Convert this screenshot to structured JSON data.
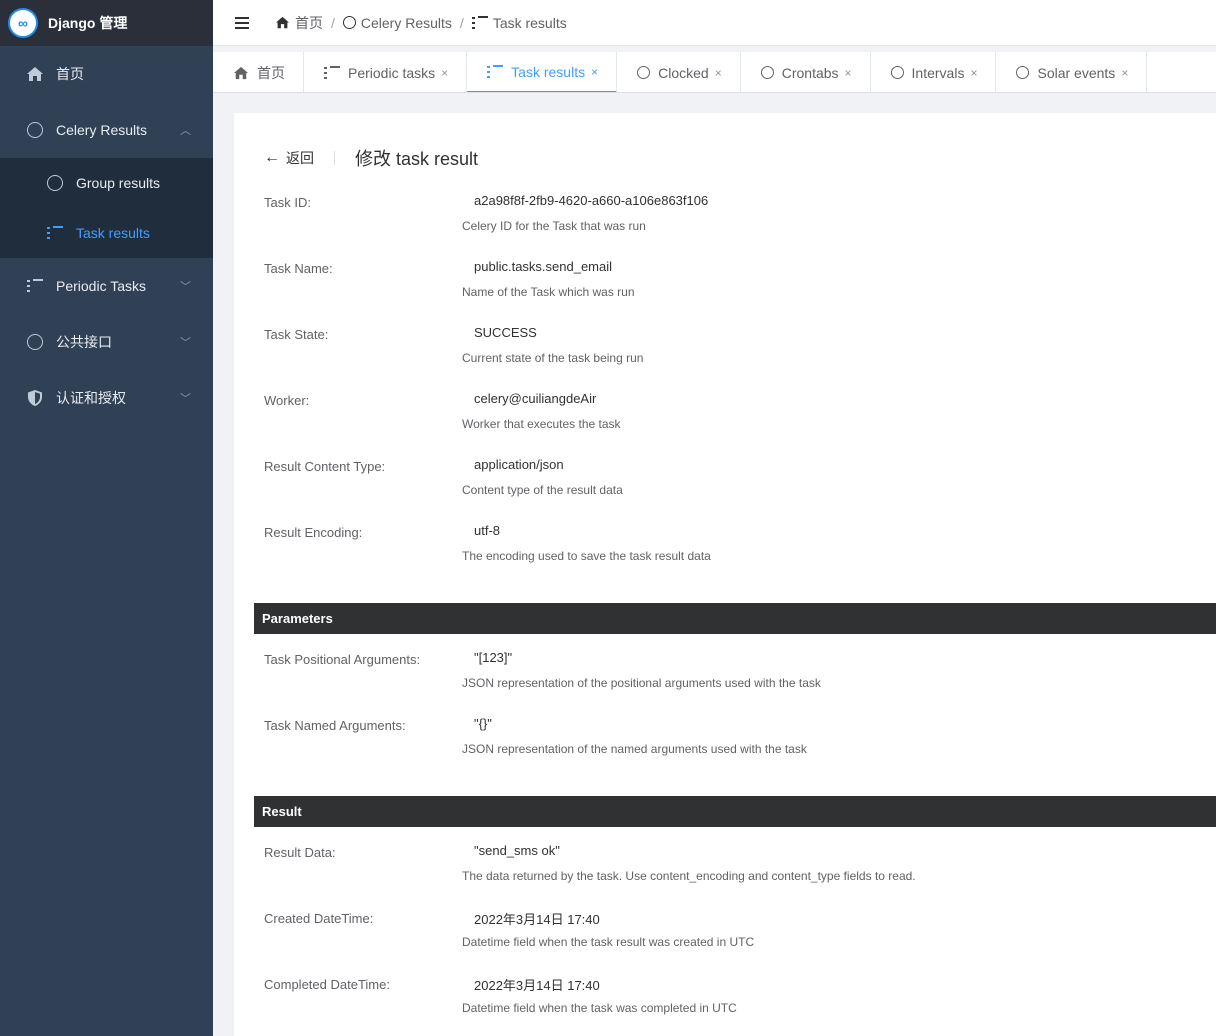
{
  "app": {
    "logo_text": "∞",
    "title": "Django 管理"
  },
  "sidebar": {
    "items": [
      {
        "label": "首页",
        "icon": "home-icon"
      },
      {
        "label": "Celery Results",
        "icon": "circle-icon",
        "chevron": "︿",
        "children": [
          {
            "label": "Group results",
            "icon": "circle-icon"
          },
          {
            "label": "Task results",
            "icon": "list-icon",
            "active": true
          }
        ]
      },
      {
        "label": "Periodic Tasks",
        "icon": "list-icon",
        "chevron": "﹀"
      },
      {
        "label": "公共接口",
        "icon": "circle-icon",
        "chevron": "﹀"
      },
      {
        "label": "认证和授权",
        "icon": "shield-icon",
        "chevron": "﹀"
      }
    ]
  },
  "breadcrumb": [
    {
      "label": "首页",
      "icon": "home-icon"
    },
    {
      "label": "Celery Results",
      "icon": "circle-icon"
    },
    {
      "label": "Task results",
      "icon": "list-icon"
    }
  ],
  "tabs": [
    {
      "label": "首页",
      "icon": "home-icon",
      "closable": false
    },
    {
      "label": "Periodic tasks",
      "icon": "list-icon",
      "closable": true
    },
    {
      "label": "Task results",
      "icon": "list-icon",
      "closable": true,
      "active": true
    },
    {
      "label": "Clocked",
      "icon": "circle-icon",
      "closable": true
    },
    {
      "label": "Crontabs",
      "icon": "circle-icon",
      "closable": true
    },
    {
      "label": "Intervals",
      "icon": "circle-icon",
      "closable": true
    },
    {
      "label": "Solar events",
      "icon": "circle-icon",
      "closable": true
    }
  ],
  "page": {
    "back_label": "返回",
    "title": "修改 task result"
  },
  "fields": [
    {
      "label": "Task ID:",
      "value": "a2a98f8f-2fb9-4620-a660-a106e863f106",
      "help": "Celery ID for the Task that was run"
    },
    {
      "label": "Task Name:",
      "value": "public.tasks.send_email",
      "help": "Name of the Task which was run"
    },
    {
      "label": "Task State:",
      "value": "SUCCESS",
      "help": "Current state of the task being run"
    },
    {
      "label": "Worker:",
      "value": "celery@cuiliangdeAir",
      "help": "Worker that executes the task"
    },
    {
      "label": "Result Content Type:",
      "value": "application/json",
      "help": "Content type of the result data"
    },
    {
      "label": "Result Encoding:",
      "value": "utf-8",
      "help": "The encoding used to save the task result data"
    }
  ],
  "parameters": {
    "heading": "Parameters",
    "fields": [
      {
        "label": "Task Positional Arguments:",
        "value": "\"[123]\"",
        "help": "JSON representation of the positional arguments used with the task"
      },
      {
        "label": "Task Named Arguments:",
        "value": "\"{}\"",
        "help": "JSON representation of the named arguments used with the task"
      }
    ]
  },
  "result": {
    "heading": "Result",
    "fields": [
      {
        "label": "Result Data:",
        "value": "\"send_sms ok\"",
        "help": "The data returned by the task. Use content_encoding and content_type fields to read."
      },
      {
        "label": "Created DateTime:",
        "value": "2022年3月14日 17:40",
        "help": "Datetime field when the task result was created in UTC"
      },
      {
        "label": "Completed DateTime:",
        "value": "2022年3月14日 17:40",
        "help": "Datetime field when the task was completed in UTC"
      }
    ]
  },
  "tab_close_glyph": "×",
  "back_arrow_glyph": "←",
  "colors": {
    "sidebar_bg": "#304156",
    "submenu_bg": "#1f2d3d",
    "accent": "#409eff",
    "fieldset_bg": "#303133"
  }
}
